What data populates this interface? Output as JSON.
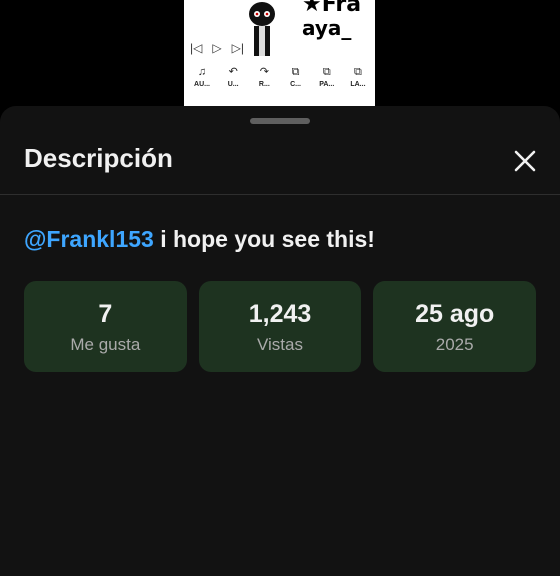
{
  "video": {
    "thumb_text_1": "★Fra",
    "thumb_text_2": "aya_",
    "controls": [
      "|◁",
      "▷",
      "▷|"
    ],
    "tools": [
      {
        "icon": "music-note-icon",
        "glyph": "♫",
        "label": "AU..."
      },
      {
        "icon": "undo-icon",
        "glyph": "↶",
        "label": "U..."
      },
      {
        "icon": "redo-icon",
        "glyph": "↷",
        "label": "R..."
      },
      {
        "icon": "copy-icon",
        "glyph": "⧉",
        "label": "C..."
      },
      {
        "icon": "paste-icon",
        "glyph": "⧉",
        "label": "PA..."
      },
      {
        "icon": "layer-icon",
        "glyph": "⧉",
        "label": "LA..."
      }
    ]
  },
  "sheet": {
    "title": "Descripción",
    "close_icon": "close-icon"
  },
  "description": {
    "mention": "@Frankl153",
    "text": " i hope you see this!"
  },
  "stats": [
    {
      "value": "7",
      "label": "Me gusta"
    },
    {
      "value": "1,243",
      "label": "Vistas"
    },
    {
      "value": "25 ago",
      "label": "2025"
    }
  ],
  "colors": {
    "accent_link": "#3ea6ff",
    "card_bg": "#1e3320",
    "sheet_bg": "#121212"
  }
}
